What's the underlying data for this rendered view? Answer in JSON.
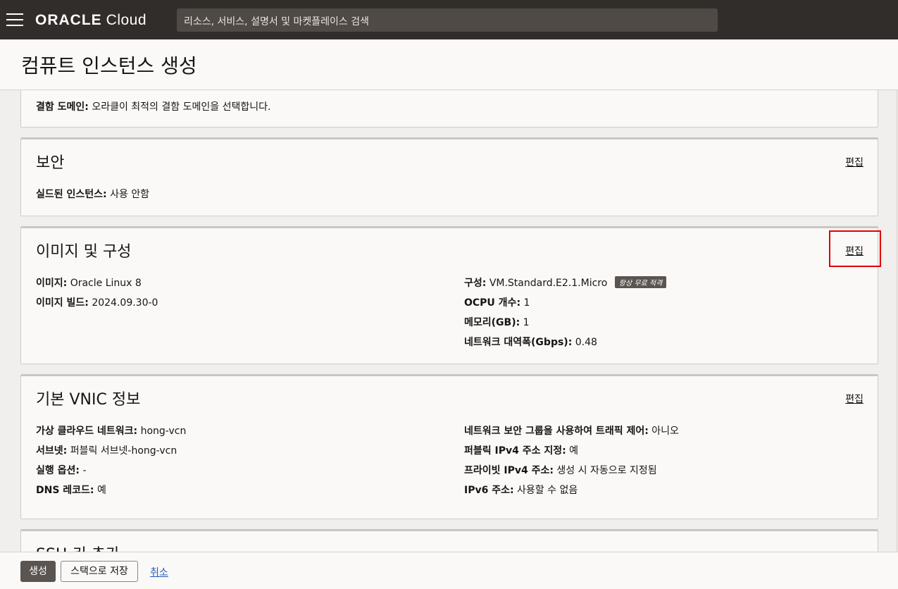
{
  "topbar": {
    "brand": "ORACLE",
    "brand_suffix": "Cloud",
    "search_placeholder": "리소스, 서비스, 설명서 및 마켓플레이스 검색"
  },
  "page": {
    "title": "컴퓨트 인스턴스 생성"
  },
  "placement": {
    "fault_domain_key": "결함 도메인:",
    "fault_domain_value": "오라클이 최적의 결함 도메인을 선택합니다."
  },
  "security": {
    "title": "보안",
    "edit": "편집",
    "shielded_key": "실드된 인스턴스:",
    "shielded_value": "사용 안함"
  },
  "image": {
    "title": "이미지 및 구성",
    "edit": "편집",
    "image_key": "이미지:",
    "image_value": "Oracle Linux 8",
    "build_key": "이미지 빌드:",
    "build_value": "2024.09.30-0",
    "shape_key": "구성:",
    "shape_value": "VM.Standard.E2.1.Micro",
    "shape_badge": "항상 무료 적격",
    "ocpu_key": "OCPU 개수:",
    "ocpu_value": "1",
    "memory_key": "메모리(GB):",
    "memory_value": "1",
    "bandwidth_key": "네트워크 대역폭(Gbps):",
    "bandwidth_value": "0.48"
  },
  "vnic": {
    "title": "기본 VNIC 정보",
    "edit": "편집",
    "vcn_key": "가상 클라우드 네트워크:",
    "vcn_value": "hong-vcn",
    "subnet_key": "서브넷:",
    "subnet_value": "퍼블릭 서브넷-hong-vcn",
    "launch_key": "실행 옵션:",
    "launch_value": "-",
    "dns_key": "DNS 레코드:",
    "dns_value": "예",
    "nsg_key": "네트워크 보안 그룹을 사용하여 트래픽 제어:",
    "nsg_value": "아니오",
    "public_ip_key": "퍼블릭 IPv4 주소 지정:",
    "public_ip_value": "예",
    "private_ip_key": "프라이빗 IPv4 주소:",
    "private_ip_value": "생성 시 자동으로 지정됨",
    "ipv6_key": "IPv6 주소:",
    "ipv6_value": "사용할 수 없음"
  },
  "ssh": {
    "title": "SSH 키 추가"
  },
  "footer": {
    "create": "생성",
    "save_stack": "스택으로 저장",
    "cancel": "취소"
  }
}
